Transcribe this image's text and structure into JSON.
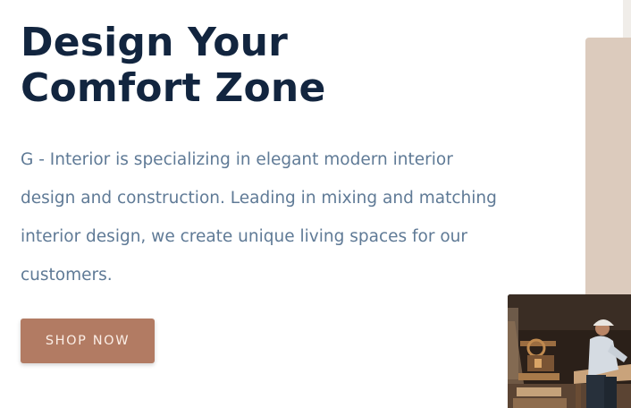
{
  "hero": {
    "title_lines": [
      "Design Your",
      "Comfort Zone"
    ],
    "description_lines": [
      "G - Interior is specializing in elegant modern interior",
      "design and construction. Leading in mixing and matching",
      "interior design, we create unique living spaces for our",
      "customers."
    ],
    "cta_label": "SHOP NOW"
  },
  "colors": {
    "title": "#12253f",
    "body_text": "#5f7a96",
    "button_bg": "#b27b63",
    "button_text": "#fbeee6",
    "panel": "#dccbbd"
  },
  "images": {
    "photo": "craftsman-working-on-wood-photo"
  }
}
